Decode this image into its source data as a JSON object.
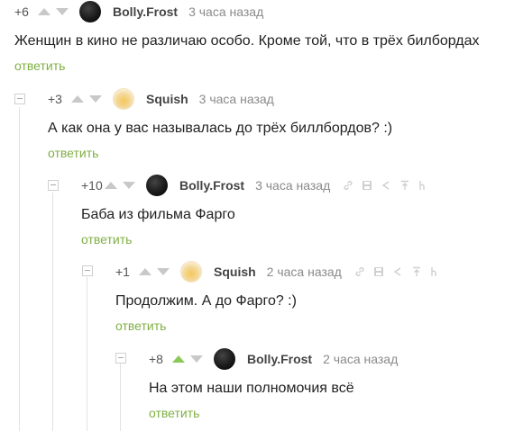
{
  "comments": [
    {
      "rating": "+6",
      "author": "Bolly.Frost",
      "time": "3 часа назад",
      "text": "Женщин в кино не различаю особо. Кроме той, что в трёх билбордах",
      "reply": "ответить",
      "avatar": "dark-avatar",
      "upvoted": false
    },
    {
      "rating": "+3",
      "author": "Squish",
      "time": "3 часа назад",
      "text": "А как она у вас называлась до трёх биллбордов? :)",
      "reply": "ответить",
      "avatar": "emoji-avatar",
      "upvoted": false
    },
    {
      "rating": "+10",
      "author": "Bolly.Frost",
      "time": "3 часа назад",
      "text": "Баба из фильма Фарго",
      "reply": "ответить",
      "avatar": "dark-avatar",
      "upvoted": false
    },
    {
      "rating": "+1",
      "author": "Squish",
      "time": "2 часа назад",
      "text": "Продолжим. А до Фарго? :)",
      "reply": "ответить",
      "avatar": "emoji-avatar",
      "upvoted": false
    },
    {
      "rating": "+8",
      "author": "Bolly.Frost",
      "time": "2 часа назад",
      "text": "На этом наши полномочия всё",
      "reply": "ответить",
      "avatar": "dark-avatar",
      "upvoted": true
    }
  ],
  "colors": {
    "reply_link": "#7fb043",
    "upvote_active": "#8ac858",
    "arrow_inactive": "#c8c8c8"
  },
  "tool_icons": [
    "link-icon",
    "save-icon",
    "share-icon",
    "pin-icon",
    "h-icon"
  ]
}
